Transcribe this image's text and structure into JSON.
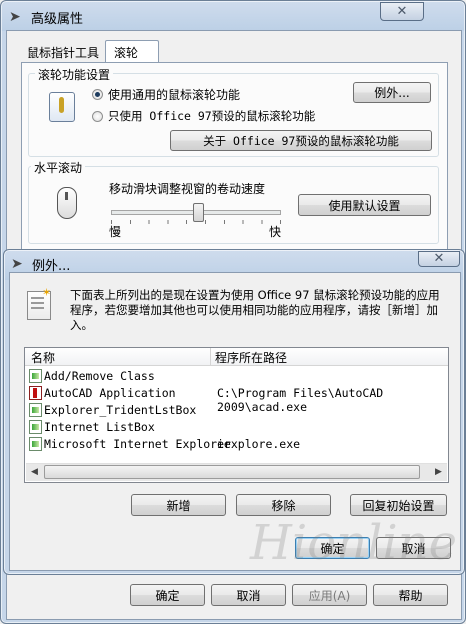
{
  "main_window": {
    "title": "高级属性",
    "tabs": [
      "鼠标指针工具",
      "滚轮"
    ],
    "wheel_group": {
      "title": "滚轮功能设置",
      "radio_general": "使用通用的鼠标滚轮功能",
      "radio_office": "只使用 Office 97预设的鼠标滚轮功能",
      "exceptions_button": "例外...",
      "about_button": "关于 Office 97预设的鼠标滚轮功能",
      "selected_option": "使用通用的鼠标滚轮功能"
    },
    "horizontal_group": {
      "title": "水平滚动",
      "slider_label": "移动滑块调整视窗的卷动速度",
      "slow_label": "慢",
      "fast_label": "快",
      "default_button": "使用默认设置"
    },
    "bottom_buttons": [
      "确定",
      "取消",
      "应用(A)",
      "帮助"
    ]
  },
  "dialog": {
    "title": "例外...",
    "description": "下面表上所列出的是现在设置为使用 Office 97 鼠标滚轮预设功能的应用程序，若您要增加其他也可以使用相同功能的应用程序，请按［新增］加入。",
    "columns": [
      "名称",
      "程序所在路径"
    ],
    "rows": [
      {
        "name": "Add/Remove Class",
        "path": "",
        "icon": "app-icon"
      },
      {
        "name": "AutoCAD Application",
        "path": "C:\\Program Files\\AutoCAD 2009\\acad.exe",
        "icon": "autocad-icon"
      },
      {
        "name": "Explorer_TridentLstBox",
        "path": "",
        "icon": "app-icon"
      },
      {
        "name": "Internet ListBox",
        "path": "",
        "icon": "app-icon"
      },
      {
        "name": "Microsoft Internet Explorer",
        "path": "iexplore.exe",
        "icon": "app-icon"
      }
    ],
    "buttons": {
      "add": "新增",
      "remove": "移除",
      "restore": "回复初始设置",
      "ok": "确定",
      "cancel": "取消"
    }
  },
  "watermark": "Hionline 嗨利在线"
}
